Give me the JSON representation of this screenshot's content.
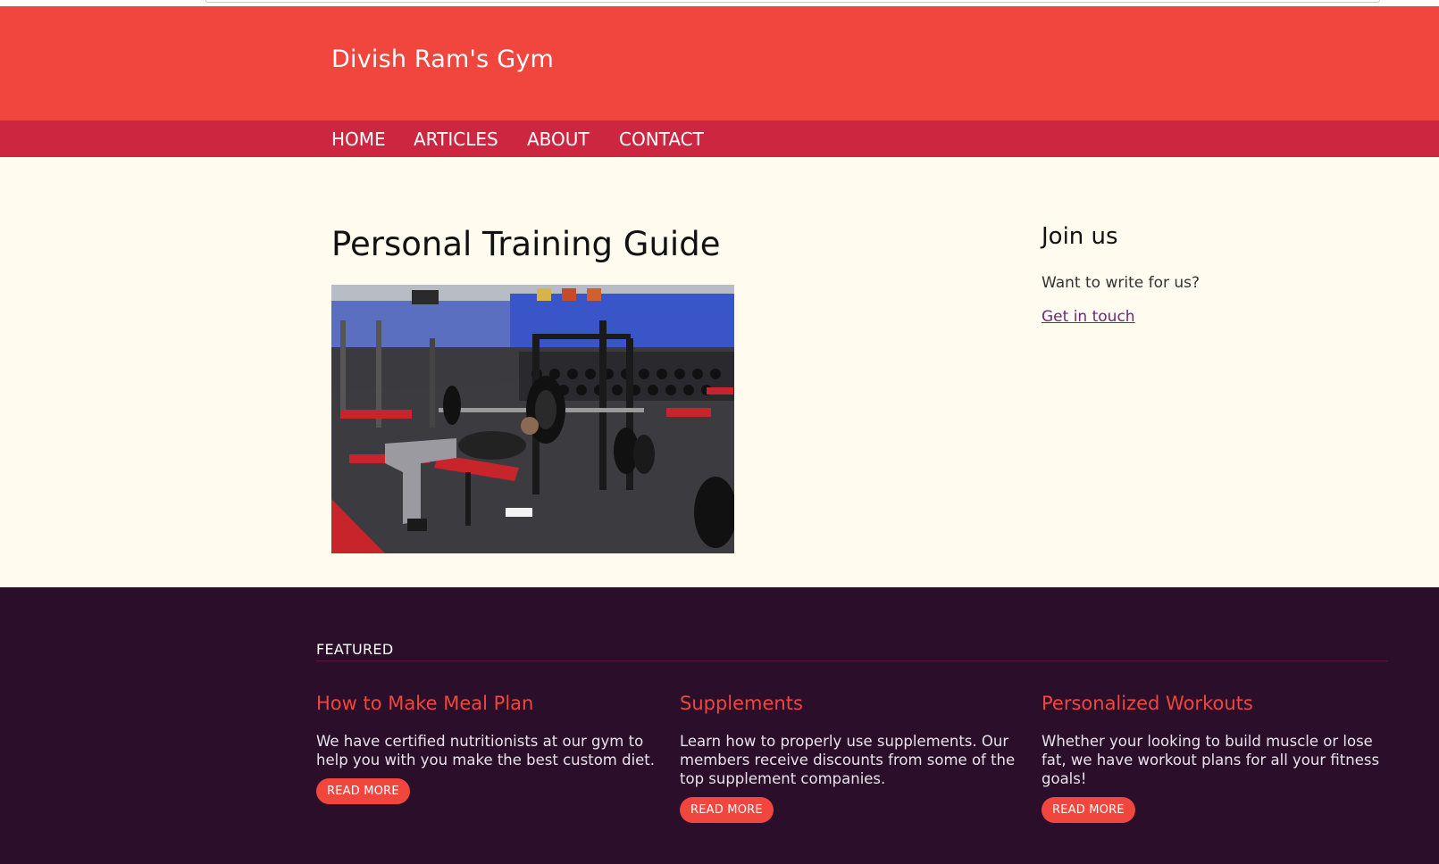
{
  "site": {
    "title": "Divish Ram's Gym"
  },
  "nav": {
    "items": [
      {
        "label": "HOME"
      },
      {
        "label": "ARTICLES"
      },
      {
        "label": "ABOUT"
      },
      {
        "label": "CONTACT"
      }
    ]
  },
  "main": {
    "title": "Personal Training Guide",
    "image": {
      "name": "gym-photo"
    }
  },
  "aside": {
    "title": "Join us",
    "text": "Want to write for us?",
    "link": "Get in touch"
  },
  "featured": {
    "label": "FEATURED",
    "cards": [
      {
        "title": "How to Make Meal Plan",
        "text": "We have certified nutritionists at our gym to help you with you make the best custom diet.",
        "button": "READ MORE"
      },
      {
        "title": "Supplements",
        "text": "Learn how to properly use supplements. Our members receive discounts from some of the top supplement companies.",
        "button": "READ MORE"
      },
      {
        "title": "Personalized Workouts",
        "text": "Whether your looking to build muscle or lose fat, we have workout plans for all your fitness goals!",
        "button": "READ MORE"
      }
    ]
  },
  "colors": {
    "header": "#f0463d",
    "nav": "#cd2640",
    "background": "#fffbef",
    "footer": "#2a0e2a",
    "accent": "#f0463d",
    "link": "#6b2a7a"
  }
}
